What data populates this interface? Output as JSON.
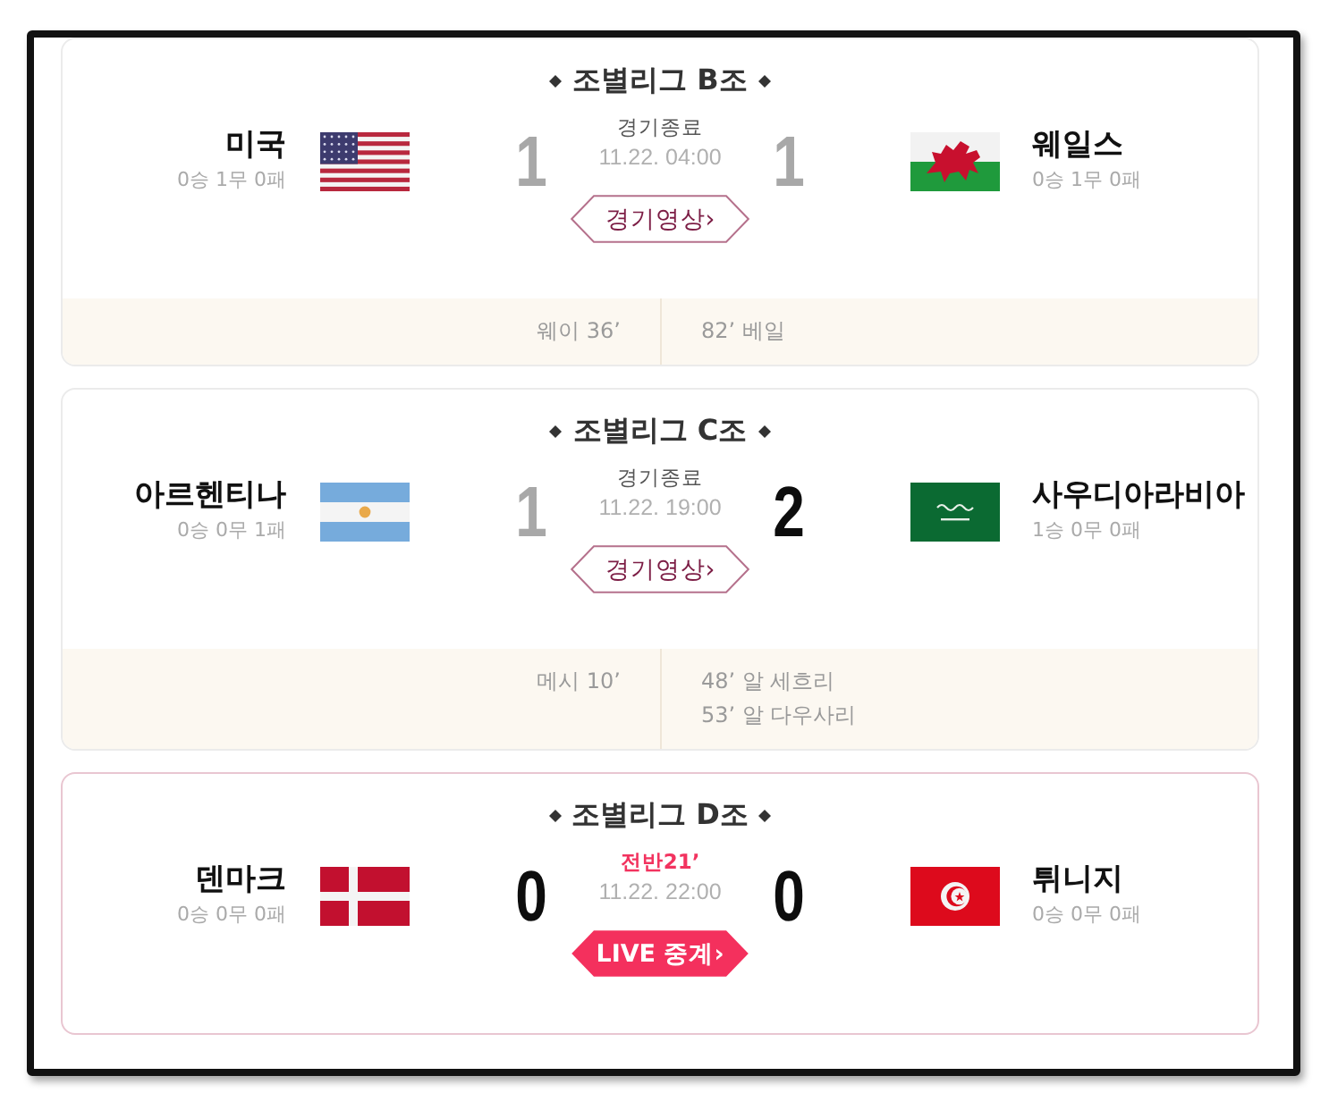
{
  "matches": [
    {
      "kind": "finished",
      "group": "조별리그 B조",
      "home": {
        "kind": "usa",
        "name": "미국",
        "record": "0승 1무 0패",
        "score": "1",
        "highlighted": false
      },
      "status": "경기종료",
      "time": "11.22. 04:00",
      "button": "경기영상›",
      "away": {
        "kind": "wales",
        "name": "웨일스",
        "record": "0승 1무 0패",
        "score": "1",
        "highlighted": false
      },
      "scorers": {
        "home": [
          "웨이 36’"
        ],
        "away": [
          "82’ 베일"
        ]
      }
    },
    {
      "kind": "finished",
      "group": "조별리그 C조",
      "home": {
        "kind": "argentina",
        "name": "아르헨티나",
        "record": "0승 0무 1패",
        "score": "1",
        "highlighted": false
      },
      "status": "경기종료",
      "time": "11.22. 19:00",
      "button": "경기영상›",
      "away": {
        "kind": "saudi",
        "name": "사우디아라비아",
        "record": "1승 0무 0패",
        "score": "2",
        "highlighted": true
      },
      "scorers": {
        "home": [
          "메시 10’"
        ],
        "away": [
          "48’ 알 세흐리",
          "53’ 알 다우사리"
        ]
      }
    },
    {
      "kind": "live",
      "group": "조별리그 D조",
      "home": {
        "kind": "denmark",
        "name": "덴마크",
        "record": "0승 0무 0패",
        "score": "0",
        "highlighted": true
      },
      "status": "전반21’",
      "time": "11.22. 22:00",
      "button": "LIVE 중계›",
      "away": {
        "kind": "tunisia",
        "name": "튀니지",
        "record": "0승 0무 0패",
        "score": "0",
        "highlighted": true
      }
    }
  ]
}
